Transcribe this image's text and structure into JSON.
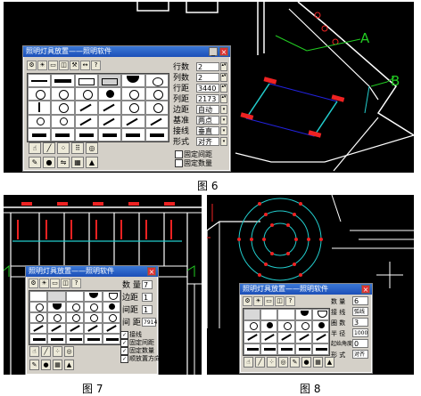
{
  "fig6": {
    "caption": "图 6",
    "label_a": "A",
    "label_b": "B",
    "dialog": {
      "title": "照明灯具放置——照明软件",
      "fields": [
        {
          "label": "行数",
          "value": "2"
        },
        {
          "label": "列数",
          "value": "2"
        },
        {
          "label": "行距",
          "value": "3440"
        },
        {
          "label": "列距",
          "value": "2173"
        },
        {
          "label": "边距",
          "value": "自动"
        },
        {
          "label": "基准",
          "value": "两点"
        },
        {
          "label": "接线",
          "value": "垂直"
        },
        {
          "label": "形式",
          "value": "对齐"
        }
      ],
      "checks": [
        {
          "label": "固定间距",
          "checked": false
        },
        {
          "label": "固定数量",
          "checked": false
        }
      ]
    }
  },
  "fig7": {
    "caption": "图 7",
    "dialog": {
      "title": "照明灯具放置——照明软件",
      "fields": [
        {
          "label": "数 量",
          "value": "7"
        },
        {
          "label": "边距",
          "value": "1"
        },
        {
          "label": "间距",
          "value": "1"
        },
        {
          "label": "间 距",
          "value": "7914"
        }
      ],
      "checks": [
        {
          "label": "接线",
          "checked": true
        },
        {
          "label": "固定间距",
          "checked": true
        },
        {
          "label": "固定数量",
          "checked": true
        },
        {
          "label": "顺放置方向",
          "checked": true
        }
      ]
    }
  },
  "fig8": {
    "caption": "图 8",
    "dialog": {
      "title": "照明灯具放置——照明软件",
      "fields": [
        {
          "label": "数 量",
          "value": "6"
        },
        {
          "label": "接 线",
          "value": "弧线"
        },
        {
          "label": "圈 数",
          "value": "3"
        },
        {
          "label": "半 径",
          "value": "1000"
        },
        {
          "label": "起始角度",
          "value": "0"
        },
        {
          "label": "形 式",
          "value": "对齐"
        }
      ]
    }
  }
}
